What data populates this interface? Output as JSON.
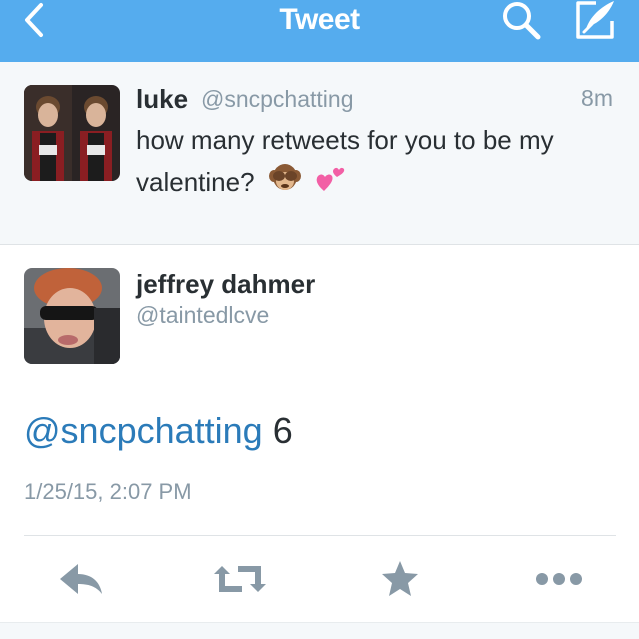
{
  "navbar": {
    "title": "Tweet",
    "background": "#55acee",
    "back_icon": "chevron-left-icon",
    "search_icon": "search-icon",
    "compose_icon": "compose-icon"
  },
  "original_tweet": {
    "name": "luke",
    "handle": "@sncpchatting",
    "time": "8m",
    "text": "how many retweets for you to be my valentine?",
    "emojis": [
      "see-no-evil-monkey-emoji",
      "two-hearts-emoji"
    ]
  },
  "reply_tweet": {
    "name": "jeffrey dahmer",
    "handle": "@taintedlcve",
    "mention": "@sncpchatting",
    "text_after_mention": " 6",
    "date": "1/25/15, 2:07 PM",
    "mention_color": "#2b7bb9"
  },
  "actions": [
    {
      "icon": "reply-icon"
    },
    {
      "icon": "retweet-icon"
    },
    {
      "icon": "favorite-star-icon"
    },
    {
      "icon": "more-icon"
    }
  ]
}
